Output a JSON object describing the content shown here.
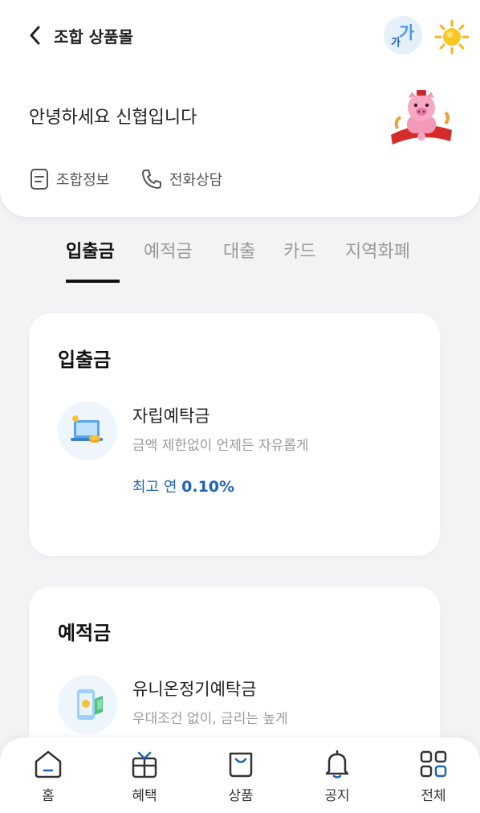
{
  "header": {
    "title": "조합 상품몰",
    "back_icon": "chevron-left-icon",
    "font_size_small": "가",
    "font_size_big": "가",
    "theme_icon": "sun-icon"
  },
  "greeting": "안녕하세요 신협입니다",
  "quick_links": [
    {
      "label": "조합정보",
      "icon": "document-icon"
    },
    {
      "label": "전화상담",
      "icon": "phone-icon"
    }
  ],
  "tabs": [
    {
      "label": "입출금",
      "active": true
    },
    {
      "label": "예적금",
      "active": false
    },
    {
      "label": "대출",
      "active": false
    },
    {
      "label": "카드",
      "active": false
    },
    {
      "label": "지역화폐",
      "active": false
    }
  ],
  "sections": [
    {
      "title": "입출금",
      "product": {
        "name": "자립예탁금",
        "desc": "금액 제한없이 언제든 자유롭게",
        "rate_prefix": "최고 연 ",
        "rate_value": "0.10%"
      }
    },
    {
      "title": "예적금",
      "product": {
        "name": "유니온정기예탁금",
        "desc": "우대조건 없이, 금리는 높게"
      }
    }
  ],
  "bottom_nav": [
    {
      "label": "홈",
      "icon": "home-icon"
    },
    {
      "label": "혜택",
      "icon": "gift-icon"
    },
    {
      "label": "상품",
      "icon": "shopping-bag-icon"
    },
    {
      "label": "공지",
      "icon": "bell-icon"
    },
    {
      "label": "전체",
      "icon": "grid-icon"
    }
  ],
  "colors": {
    "accent_blue": "#1e63b5",
    "background": "#f3f3f5",
    "card": "#ffffff"
  }
}
